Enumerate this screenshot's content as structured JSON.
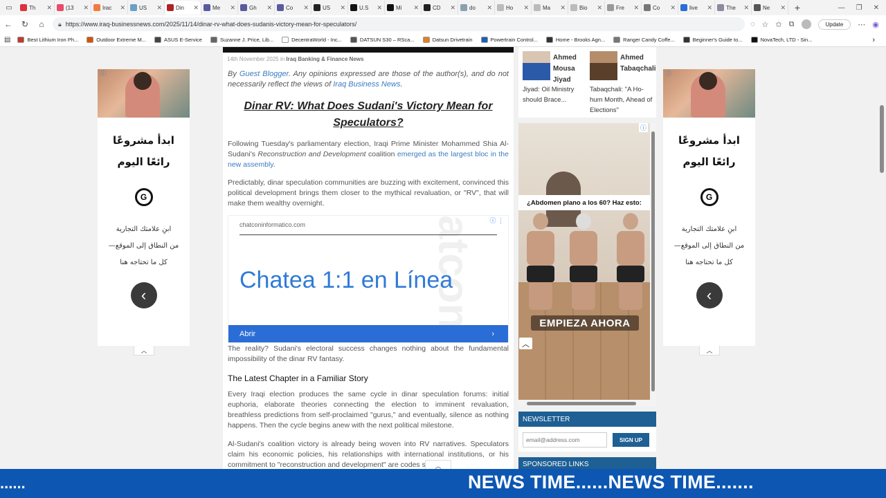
{
  "tabs": [
    {
      "label": "Th",
      "color": "#d9333f"
    },
    {
      "label": "(13",
      "color": "#e84b6a"
    },
    {
      "label": "Irac",
      "color": "#f07b3f"
    },
    {
      "label": "US",
      "color": "#6aa0c8"
    },
    {
      "label": "Din",
      "color": "#b22222",
      "active": true
    },
    {
      "label": "Me",
      "color": "#5a5aa0"
    },
    {
      "label": "Gh",
      "color": "#5a5aa0"
    },
    {
      "label": "Co",
      "color": "#5a5aa0"
    },
    {
      "label": "US",
      "color": "#222222"
    },
    {
      "label": "U.S",
      "color": "#111111"
    },
    {
      "label": "Mi",
      "color": "#111111"
    },
    {
      "label": "CD",
      "color": "#222222"
    },
    {
      "label": "do",
      "color": "#8aa0b0"
    },
    {
      "label": "Ho",
      "color": "#bbbbbb"
    },
    {
      "label": "Ma",
      "color": "#bbbbbb"
    },
    {
      "label": "Bio",
      "color": "#bbbbbb"
    },
    {
      "label": "Fre",
      "color": "#999999"
    },
    {
      "label": "Co",
      "color": "#777777"
    },
    {
      "label": "live",
      "color": "#2a6dd6"
    },
    {
      "label": "The",
      "color": "#8a8aa0"
    },
    {
      "label": "Ne",
      "color": "#555555"
    }
  ],
  "address": {
    "url": "https://www.iraq-businessnews.com/2025/11/14/dinar-rv-what-does-sudanis-victory-mean-for-speculators/",
    "update_label": "Update"
  },
  "bookmarks": [
    {
      "label": "Best Lithium Iron Ph...",
      "color": "#c0392b"
    },
    {
      "label": "Outdoor Extreme M...",
      "color": "#d35400"
    },
    {
      "label": "ASUS E-Service",
      "color": "#444444"
    },
    {
      "label": "Suzanne J. Price, Lib...",
      "color": "#666666"
    },
    {
      "label": "DecentraWorld - Inc...",
      "color": "#ffffff"
    },
    {
      "label": "DATSUN S30 – RSca...",
      "color": "#555555"
    },
    {
      "label": "Datsun Drivetrain",
      "color": "#e67e22"
    },
    {
      "label": "Powertrain Control...",
      "color": "#1e5fb4"
    },
    {
      "label": "Home - Brooks Agn...",
      "color": "#333333"
    },
    {
      "label": "Ranger Candy Coffe...",
      "color": "#777777"
    },
    {
      "label": "Beginner's Guide to...",
      "color": "#333333"
    },
    {
      "label": "NovaTech, LTD - Sin...",
      "color": "#111111"
    }
  ],
  "side_ad": {
    "title_line1": "ابدأ مشروعًا",
    "title_line2": "رائعًا اليوم",
    "logo": "G",
    "body_line1": "ابنِ علامتك التجارية",
    "body_line2": "من النطاق إلى الموقع—",
    "body_line3": "كل ما تحتاجه هنا",
    "arrow": "‹"
  },
  "article": {
    "date": "14th November 2025",
    "in": "in",
    "category": "Iraq Banking & Finance News",
    "byline_by": "By",
    "byline_author": "Guest Blogger",
    "byline_disclaimer": ". Any opinions expressed are those of the author(s), and do not necessarily reflect the views of",
    "byline_site": "Iraq Business News",
    "byline_end": ".",
    "headline": "Dinar RV: What Does Sudani's Victory Mean for Speculators?",
    "p1_a": "Following Tuesday's parliamentary election, Iraqi Prime Minister Mohammed Shia Al-Sudani's",
    "p1_italic": "Reconstruction and Development",
    "p1_b": "coalition",
    "p1_link": "emerged as the largest bloc in the new assembly",
    "p1_end": ".",
    "p2": "Predictably, dinar speculation communities are buzzing with excitement, convinced this political development brings them closer to the mythical revaluation, or \"RV\", that will make them wealthy overnight.",
    "p3": "The reality? Sudani's electoral success changes nothing about the fundamental impossibility of the dinar RV fantasy.",
    "subhead": "The Latest Chapter in a Familiar Story",
    "p4": "Every Iraqi election produces the same cycle in dinar speculation forums: initial euphoria, elaborate theories connecting the election to imminent revaluation, breathless predictions from self-proclaimed \"gurus,\" and eventually, silence as nothing happens. Then the cycle begins anew with the next political milestone.",
    "p5": "Al-Sudani's coalition victory is already being woven into RV narratives. Speculators claim his economic policies, his relationships with international institutions, or his commitment to \"reconstruction and development\" are codes signaling"
  },
  "inline_ad": {
    "domain": "chatconinformatico.com",
    "headline": "Chatea 1:1 en Línea",
    "cta": "Abrir",
    "watermark": "chatcon"
  },
  "related": [
    {
      "name_line1": "Ahmed",
      "name_line2": "Mousa Jiyad",
      "text": "Jiyad: Oil Ministry should Brace...",
      "thumb_color": "#2b5aa8"
    },
    {
      "name_line1": "Ahmed",
      "name_line2": "Tabaqchali",
      "text": "Tabaqchali: \"A Ho-hum Month, Ahead of Elections\"",
      "thumb_color": "#7a5a3a"
    }
  ],
  "right_ad": {
    "caption": "¿Abdomen plano a los 60? Haz esto:",
    "cta": "EMPIEZA AHORA"
  },
  "newsletter": {
    "heading": "NEWSLETTER",
    "placeholder": "email@address.com",
    "button": "SIGN UP"
  },
  "sponsored": {
    "heading": "SPONSORED LINKS"
  },
  "ticker": {
    "left_text": "......",
    "main_text": "NEWS TIME......NEWS TIME......."
  },
  "colors": {
    "link": "#3b7bbf",
    "navy": "#1e5f94",
    "ticker": "#0d57b3",
    "cta_blue": "#2a6dd6"
  }
}
